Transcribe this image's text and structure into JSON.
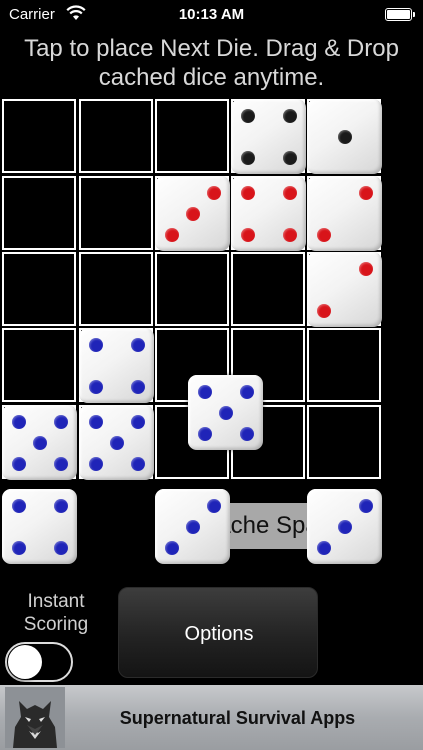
{
  "status_bar": {
    "carrier": "Carrier",
    "time": "10:13 AM"
  },
  "instructions": {
    "line1": "Tap to place Next Die. Drag & Drop",
    "line2": "cached dice anytime."
  },
  "colors": {
    "black_pip": "#1a1a1a",
    "red_pip": "#d8141a",
    "blue_pip": "#1f24b8"
  },
  "board": {
    "rows": 5,
    "cols": 5,
    "dice": [
      {
        "row": 0,
        "col": 3,
        "value": 4,
        "color": "black"
      },
      {
        "row": 0,
        "col": 4,
        "value": 1,
        "color": "black"
      },
      {
        "row": 1,
        "col": 2,
        "value": 3,
        "color": "red"
      },
      {
        "row": 1,
        "col": 3,
        "value": 4,
        "color": "red"
      },
      {
        "row": 1,
        "col": 4,
        "value": 2,
        "color": "red"
      },
      {
        "row": 2,
        "col": 4,
        "value": 2,
        "color": "red"
      },
      {
        "row": 3,
        "col": 1,
        "value": 4,
        "color": "blue"
      },
      {
        "row": 4,
        "col": 0,
        "value": 5,
        "color": "blue"
      },
      {
        "row": 4,
        "col": 1,
        "value": 5,
        "color": "blue"
      }
    ]
  },
  "next_die": {
    "value": 5,
    "color": "blue"
  },
  "cache": {
    "button_label": "Cache Space",
    "dice": [
      {
        "slot": 0,
        "value": 4,
        "color": "blue"
      },
      {
        "slot": 2,
        "value": 3,
        "color": "blue"
      },
      {
        "slot": 4,
        "value": 3,
        "color": "blue"
      }
    ]
  },
  "instant_scoring": {
    "label_line1": "Instant",
    "label_line2": "Scoring",
    "enabled": false
  },
  "options_button": {
    "label": "Options"
  },
  "ad_banner": {
    "title": "Supernatural Survival Apps",
    "logo_icon": "werewolf-logo-icon"
  }
}
